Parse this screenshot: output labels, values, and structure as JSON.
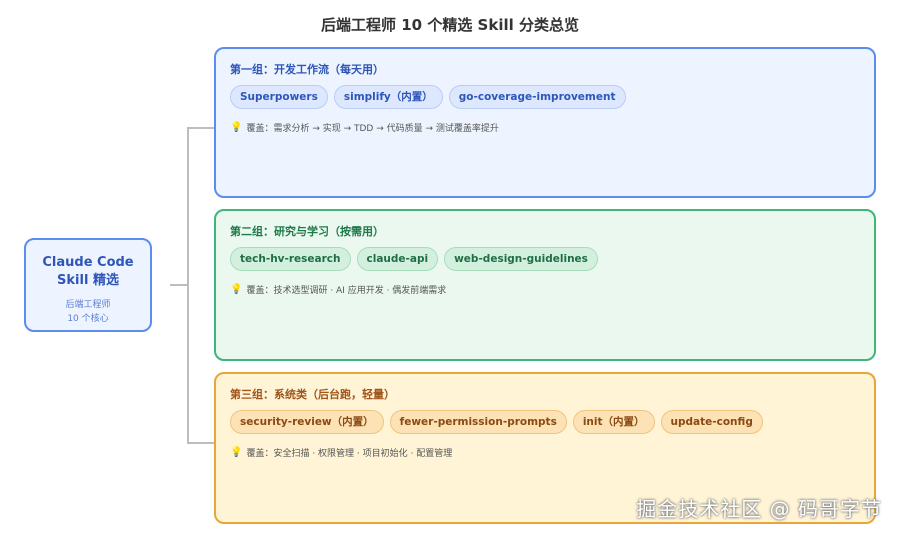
{
  "title": "后端工程师 10 个精选 Skill 分类总览",
  "root": {
    "title_line1": "Claude Code",
    "title_line2": "Skill 精选",
    "sub_line1": "后端工程师",
    "sub_line2": "10 个核心"
  },
  "groups": [
    {
      "title": "第一组：开发工作流（每天用）",
      "chips": [
        "Superpowers",
        "simplify（内置）",
        "go-coverage-improvement"
      ],
      "cover": "覆盖：需求分析 → 实现 → TDD → 代码质量 → 测试覆盖率提升"
    },
    {
      "title": "第二组：研究与学习（按需用）",
      "chips": [
        "tech-hv-research",
        "claude-api",
        "web-design-guidelines"
      ],
      "cover": "覆盖：技术选型调研 · AI 应用开发 · 偶发前端需求"
    },
    {
      "title": "第三组：系统类（后台跑，轻量）",
      "chips": [
        "security-review（内置）",
        "fewer-permission-prompts",
        "init（内置）",
        "update-config"
      ],
      "cover": "覆盖：安全扫描 · 权限管理 · 项目初始化 · 配置管理"
    }
  ],
  "icons": {
    "cover_icon": "lightbulb-icon"
  },
  "watermark": "掘金技术社区 @ 码哥字节",
  "colors": {
    "blue": "#5b8def",
    "green": "#3fb57a",
    "orange": "#e8a53a"
  }
}
